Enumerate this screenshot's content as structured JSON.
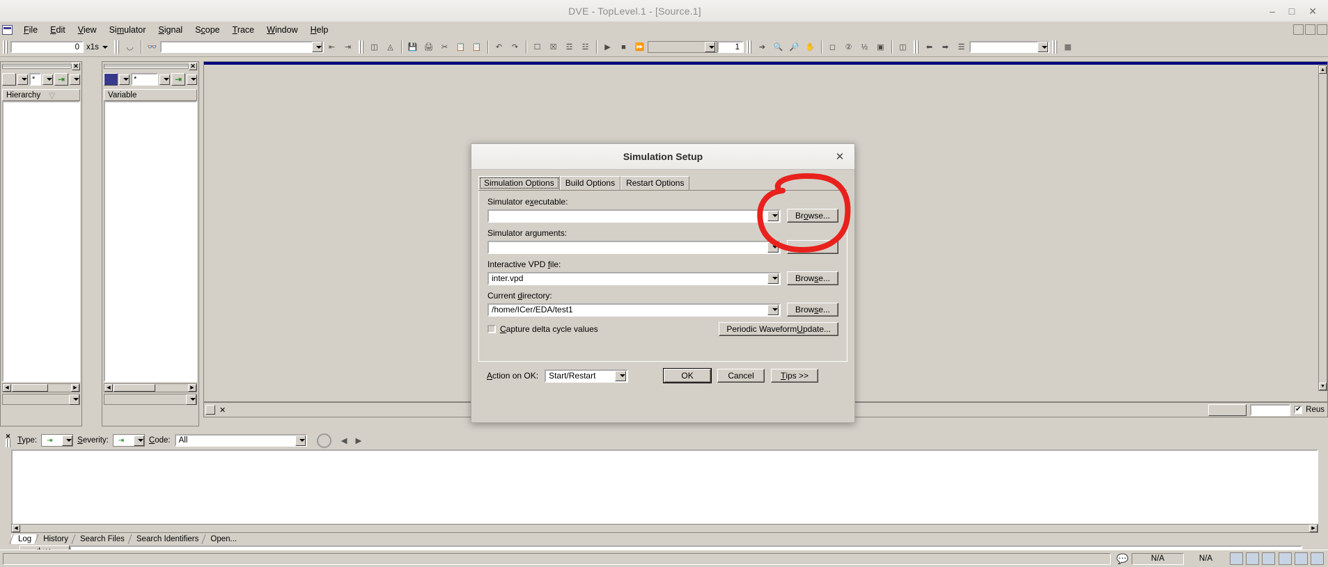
{
  "window": {
    "title": "DVE - TopLevel.1 - [Source.1]",
    "minimize": "–",
    "maximize": "□",
    "close": "✕"
  },
  "menubar": {
    "system_icon": "system-menu-icon",
    "items": [
      {
        "pre": "",
        "mn": "F",
        "post": "ile"
      },
      {
        "pre": "",
        "mn": "E",
        "post": "dit"
      },
      {
        "pre": "",
        "mn": "V",
        "post": "iew"
      },
      {
        "pre": "Si",
        "mn": "m",
        "post": "ulator"
      },
      {
        "pre": "",
        "mn": "S",
        "post": "ignal"
      },
      {
        "pre": "S",
        "mn": "c",
        "post": "ope"
      },
      {
        "pre": "",
        "mn": "T",
        "post": "race"
      },
      {
        "pre": "",
        "mn": "W",
        "post": "indow"
      },
      {
        "pre": "",
        "mn": "H",
        "post": "elp"
      }
    ]
  },
  "toolbar": {
    "time_value": "0",
    "time_unit": "x1s",
    "search_value": "",
    "zoom_value": "1",
    "right_combo_value": ""
  },
  "hierarchy_panel": {
    "title": "Hierarchy",
    "filter_value": "*",
    "close_label": "✕"
  },
  "variable_panel": {
    "title": "Variable",
    "filter_value": "*",
    "close_label": "✕"
  },
  "source_pane": {
    "reuse_label": "Reus",
    "reuse_checked": true,
    "reuse_mark": "✔",
    "field_value": ""
  },
  "log_pane": {
    "type_label_pre": "",
    "type_label_mn": "T",
    "type_label_post": "ype:",
    "severity_label_mn": "S",
    "severity_label_post": "everity:",
    "code_label_mn": "C",
    "code_label_post": "ode:",
    "code_value": "All",
    "tabs": [
      "Log",
      "History",
      "Search Files",
      "Search Identifiers",
      "Open..."
    ],
    "prompt": "dve>",
    "command_value": ""
  },
  "statusbar": {
    "left_text": "",
    "value_1": "N/A",
    "value_2": "N/A"
  },
  "dialog": {
    "title": "Simulation Setup",
    "close_label": "✕",
    "tabs": [
      {
        "label": "Simulation Options",
        "active": true
      },
      {
        "label": "Build Options",
        "active": false
      },
      {
        "label": "Restart Options",
        "active": false
      }
    ],
    "fields": [
      {
        "label_pre": "Simulator e",
        "label_mn": "x",
        "label_post": "ecutable:",
        "value": "",
        "button_pre": "Br",
        "button_mn": "o",
        "button_post": "wse..."
      },
      {
        "label_pre": "Simulator ar",
        "label_mn": "g",
        "label_post": "uments:",
        "value": "",
        "button_pre": "",
        "button_mn": "",
        "button_post": "..."
      },
      {
        "label_pre": "Interactive VPD ",
        "label_mn": "f",
        "label_post": "ile:",
        "value": "inter.vpd",
        "button_pre": "Brow",
        "button_mn": "s",
        "button_post": "e..."
      },
      {
        "label_pre": "Current ",
        "label_mn": "d",
        "label_post": "irectory:",
        "value": "/home/ICer/EDA/test1",
        "button_pre": "Brow",
        "button_mn": "s",
        "button_post": "e..."
      }
    ],
    "checkbox": {
      "pre": "",
      "mn": "C",
      "post": "apture delta cycle values",
      "checked": false
    },
    "periodic_button": {
      "pre": "Periodic Waveform ",
      "mn": "U",
      "post": "pdate..."
    },
    "action_label": {
      "pre": "",
      "mn": "A",
      "post": "ction on OK:"
    },
    "action_value": "Start/Restart",
    "ok_label": "OK",
    "cancel_label": "Cancel",
    "tips_pre": "",
    "tips_mn": "T",
    "tips_post": "ips >>"
  },
  "annotation": {
    "color": "#e8211c",
    "target": "browse-button-simulator-executable"
  }
}
